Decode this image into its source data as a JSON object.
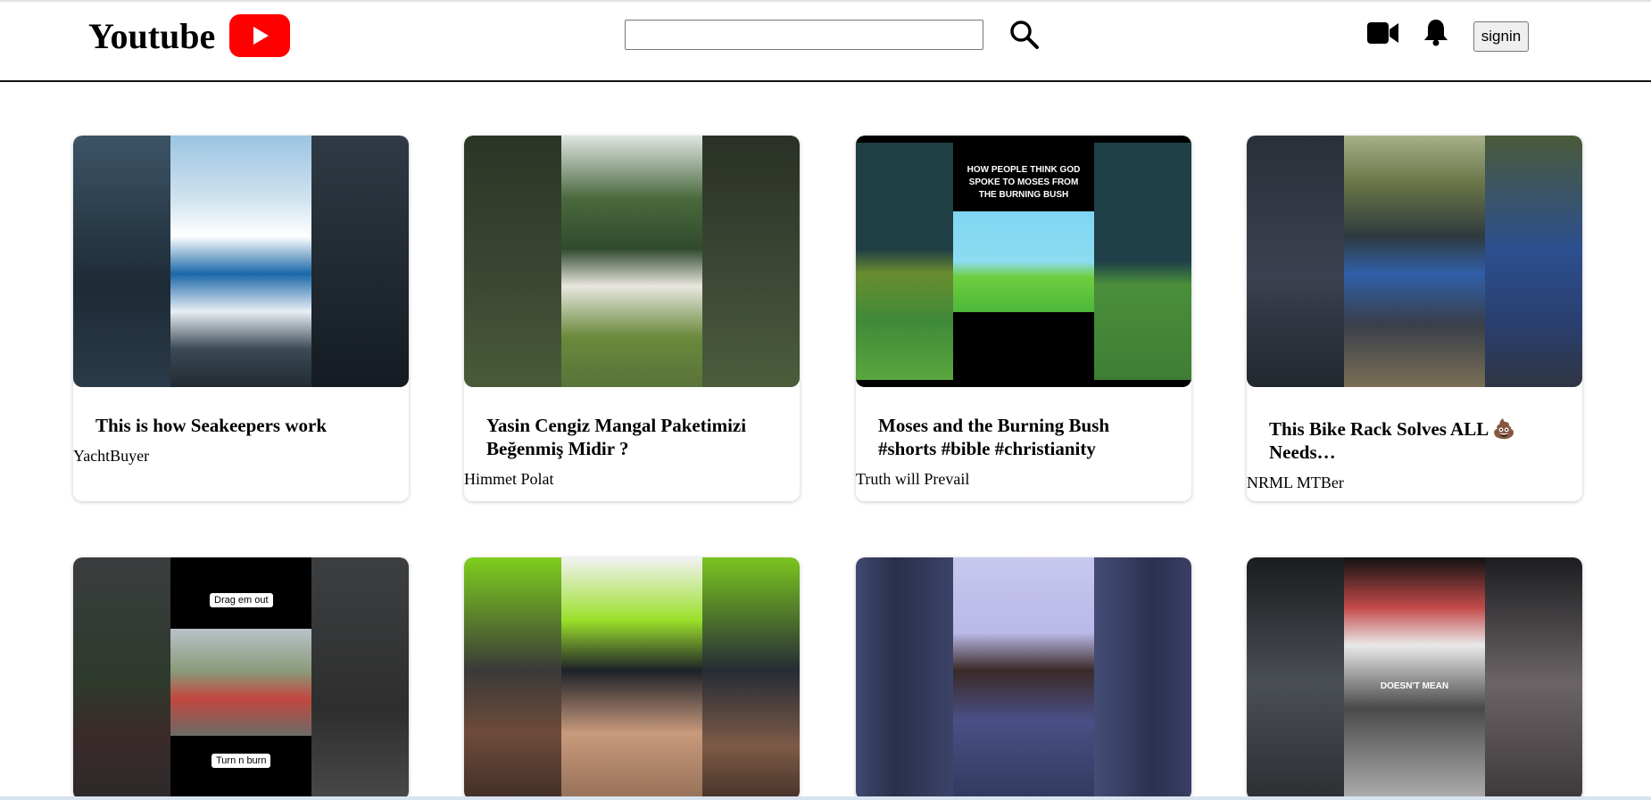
{
  "header": {
    "logo_text": "Youtube",
    "search_placeholder": "",
    "search_value": "",
    "signin_label": "signin"
  },
  "icons": {
    "logo": "youtube-play-icon",
    "search": "search-icon",
    "video": "video-camera-icon",
    "notifications": "bell-icon"
  },
  "colors": {
    "brand_red": "#ff0000",
    "header_border": "#111111"
  },
  "videos": [
    {
      "title": "This is how Seakeepers work",
      "channel": "YachtBuyer"
    },
    {
      "title": "Yasin Cengiz Mangal Paketimizi Beğenmiş Midir ?",
      "channel": "Himmet Polat"
    },
    {
      "title": "Moses and the Burning Bush #shorts #bible #christianity",
      "channel": "Truth will Prevail",
      "thumb_text": "HOW PEOPLE THINK GOD SPOKE TO MOSES FROM THE BURNING BUSH"
    },
    {
      "title": "This Bike Rack Solves ALL 💩 Needs…",
      "channel": "NRML MTBer"
    },
    {
      "title": "",
      "channel": "",
      "thumb_text_top": "Drag em out",
      "thumb_text_bottom": "Turn n burn"
    },
    {
      "title": "",
      "channel": ""
    },
    {
      "title": "",
      "channel": ""
    },
    {
      "title": "",
      "channel": "",
      "thumb_text": "DOESN'T MEAN"
    }
  ]
}
